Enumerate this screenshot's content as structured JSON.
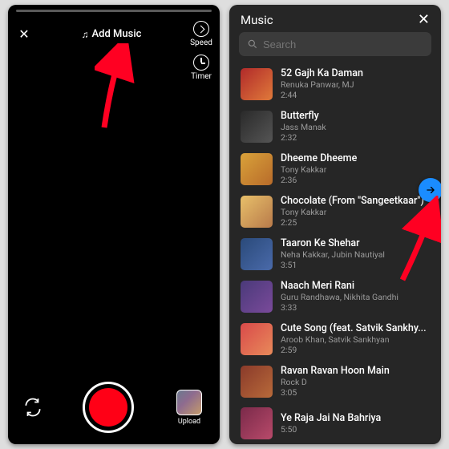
{
  "left": {
    "add_music_label": "Add Music",
    "speed_label": "Speed",
    "timer_label": "Timer",
    "upload_label": "Upload"
  },
  "right": {
    "title": "Music",
    "search_placeholder": "Search",
    "songs": [
      {
        "title": "52 Gajh Ka Daman",
        "artist": "Renuka Panwar, MJ",
        "duration": "2:44"
      },
      {
        "title": "Butterfly",
        "artist": "Jass Manak",
        "duration": "2:32"
      },
      {
        "title": "Dheeme Dheeme",
        "artist": "Tony Kakkar",
        "duration": "2:36"
      },
      {
        "title": "Chocolate (From \"Sangeetkaar\")",
        "artist": "Tony Kakkar",
        "duration": "2:25"
      },
      {
        "title": "Taaron Ke Shehar",
        "artist": "Neha Kakkar, Jubin Nautiyal",
        "duration": "3:51"
      },
      {
        "title": "Naach Meri Rani",
        "artist": "Guru Randhawa, Nikhita Gandhi",
        "duration": "3:33"
      },
      {
        "title": "Cute Song (feat. Satvik Sankhy...",
        "artist": "Aroob Khan, Satvik Sankhyan",
        "duration": "2:59"
      },
      {
        "title": "Ravan Ravan Hoon Main",
        "artist": "Rock D",
        "duration": "3:05"
      },
      {
        "title": "Ye Raja Jai Na Bahriya",
        "artist": "",
        "duration": "5:50"
      }
    ]
  }
}
